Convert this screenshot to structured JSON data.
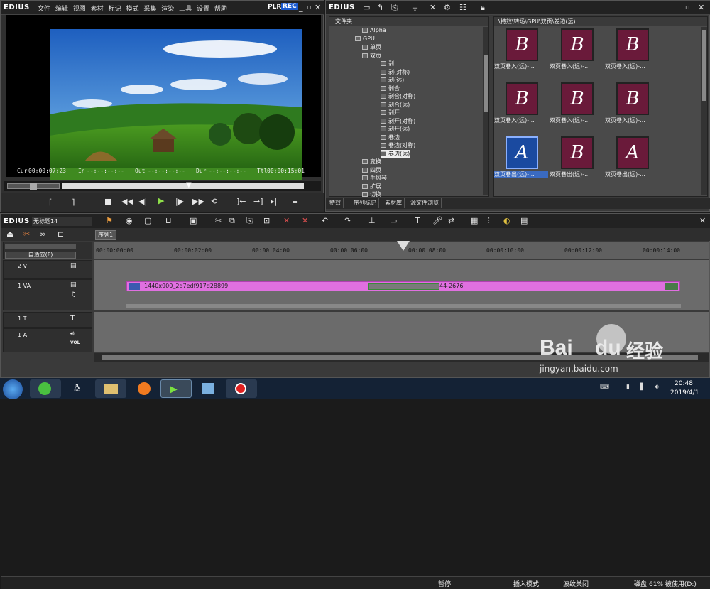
{
  "player": {
    "brand": "EDIUS",
    "menu": [
      "文件",
      "编辑",
      "视图",
      "素材",
      "标记",
      "模式",
      "采集",
      "渲染",
      "工具",
      "设置",
      "帮助"
    ],
    "mode_plr": "PLR",
    "mode_rec": "REC",
    "timecodes": {
      "cur_label": "Cur",
      "cur": "00:00:07:23",
      "in_label": "In",
      "in": "--:--:--:--",
      "out_label": "Out",
      "out": "--:--:--:--",
      "dur_label": "Dur",
      "dur": "--:--:--:--",
      "ttl_label": "Ttl",
      "ttl": "00:00:15:01"
    }
  },
  "bin": {
    "brand": "EDIUS",
    "tree_header": "文件夹",
    "path": "\\特效\\转场\\GPU\\双页\\卷边(远)",
    "tree": [
      {
        "label": "Alpha",
        "level": 2
      },
      {
        "label": "GPU",
        "level": 1
      },
      {
        "label": "单页",
        "level": 2
      },
      {
        "label": "双页",
        "level": 2
      },
      {
        "label": "剥",
        "level": 3
      },
      {
        "label": "剥(对称)",
        "level": 3
      },
      {
        "label": "剥(远)",
        "level": 3
      },
      {
        "label": "剥合",
        "level": 3
      },
      {
        "label": "剥合(对称)",
        "level": 3
      },
      {
        "label": "剥合(远)",
        "level": 3
      },
      {
        "label": "剥开",
        "level": 3
      },
      {
        "label": "剥开(对称)",
        "level": 3
      },
      {
        "label": "剥开(远)",
        "level": 3
      },
      {
        "label": "卷边",
        "level": 3
      },
      {
        "label": "卷边(对称)",
        "level": 3
      },
      {
        "label": "卷边(远)",
        "level": 3,
        "selected": true
      },
      {
        "label": "变换",
        "level": 2
      },
      {
        "label": "四页",
        "level": 2
      },
      {
        "label": "手风琴",
        "level": 2
      },
      {
        "label": "扩展",
        "level": 2
      },
      {
        "label": "切换",
        "level": 2
      }
    ],
    "thumbs": [
      {
        "letter": "B",
        "label": "双页卷入(远)-..."
      },
      {
        "letter": "B",
        "label": "双页卷入(远)-..."
      },
      {
        "letter": "B",
        "label": "双页卷入(远)-..."
      },
      {
        "letter": "B",
        "label": "双页卷入(远)-..."
      },
      {
        "letter": "B",
        "label": "双页卷入(远)-..."
      },
      {
        "letter": "B",
        "label": "双页卷入(远)-..."
      },
      {
        "letter": "A",
        "label": "双页卷出(远)-...",
        "selected": true
      },
      {
        "letter": "B",
        "label": "双页卷出(远)-..."
      },
      {
        "letter": "A",
        "label": "双页卷出(远)-..."
      }
    ],
    "tabs": [
      "特效",
      "序列标记",
      "素材库",
      "源文件浏览"
    ]
  },
  "timeline": {
    "brand": "EDIUS",
    "project": "无标题14",
    "sequence_tab": "序列1",
    "auto_mode": "自适应(F)",
    "ruler": [
      "00:00:00:00",
      "00:00:02:00",
      "00:00:04:00",
      "00:00:06:00",
      "00:00:08:00",
      "00:00:10:00",
      "00:00:12:00",
      "00:00:14:00"
    ],
    "tracks": [
      {
        "name": "2 V"
      },
      {
        "name": "1 VA"
      },
      {
        "name": "1 T"
      },
      {
        "name": "1 A",
        "vol": "VOL"
      }
    ],
    "clip_a": "1440x900_2d7edf917d28899",
    "clip_b": "44-2676",
    "status": {
      "pause": "暂停",
      "insert_mode": "插入模式",
      "ripple": "波纹关闭",
      "disk": "磁盘:61% 被使用(D:)"
    }
  },
  "taskbar": {
    "time": "20:48",
    "date": "2019/4/1"
  },
  "watermark": {
    "brand_a": "Bai",
    "brand_b": "du",
    "brand_c": "经验",
    "url": "jingyan.baidu.com"
  },
  "colors": {
    "clip": "#e070e0",
    "selected": "#3a6ac0",
    "rec": "#1a5ad0"
  }
}
